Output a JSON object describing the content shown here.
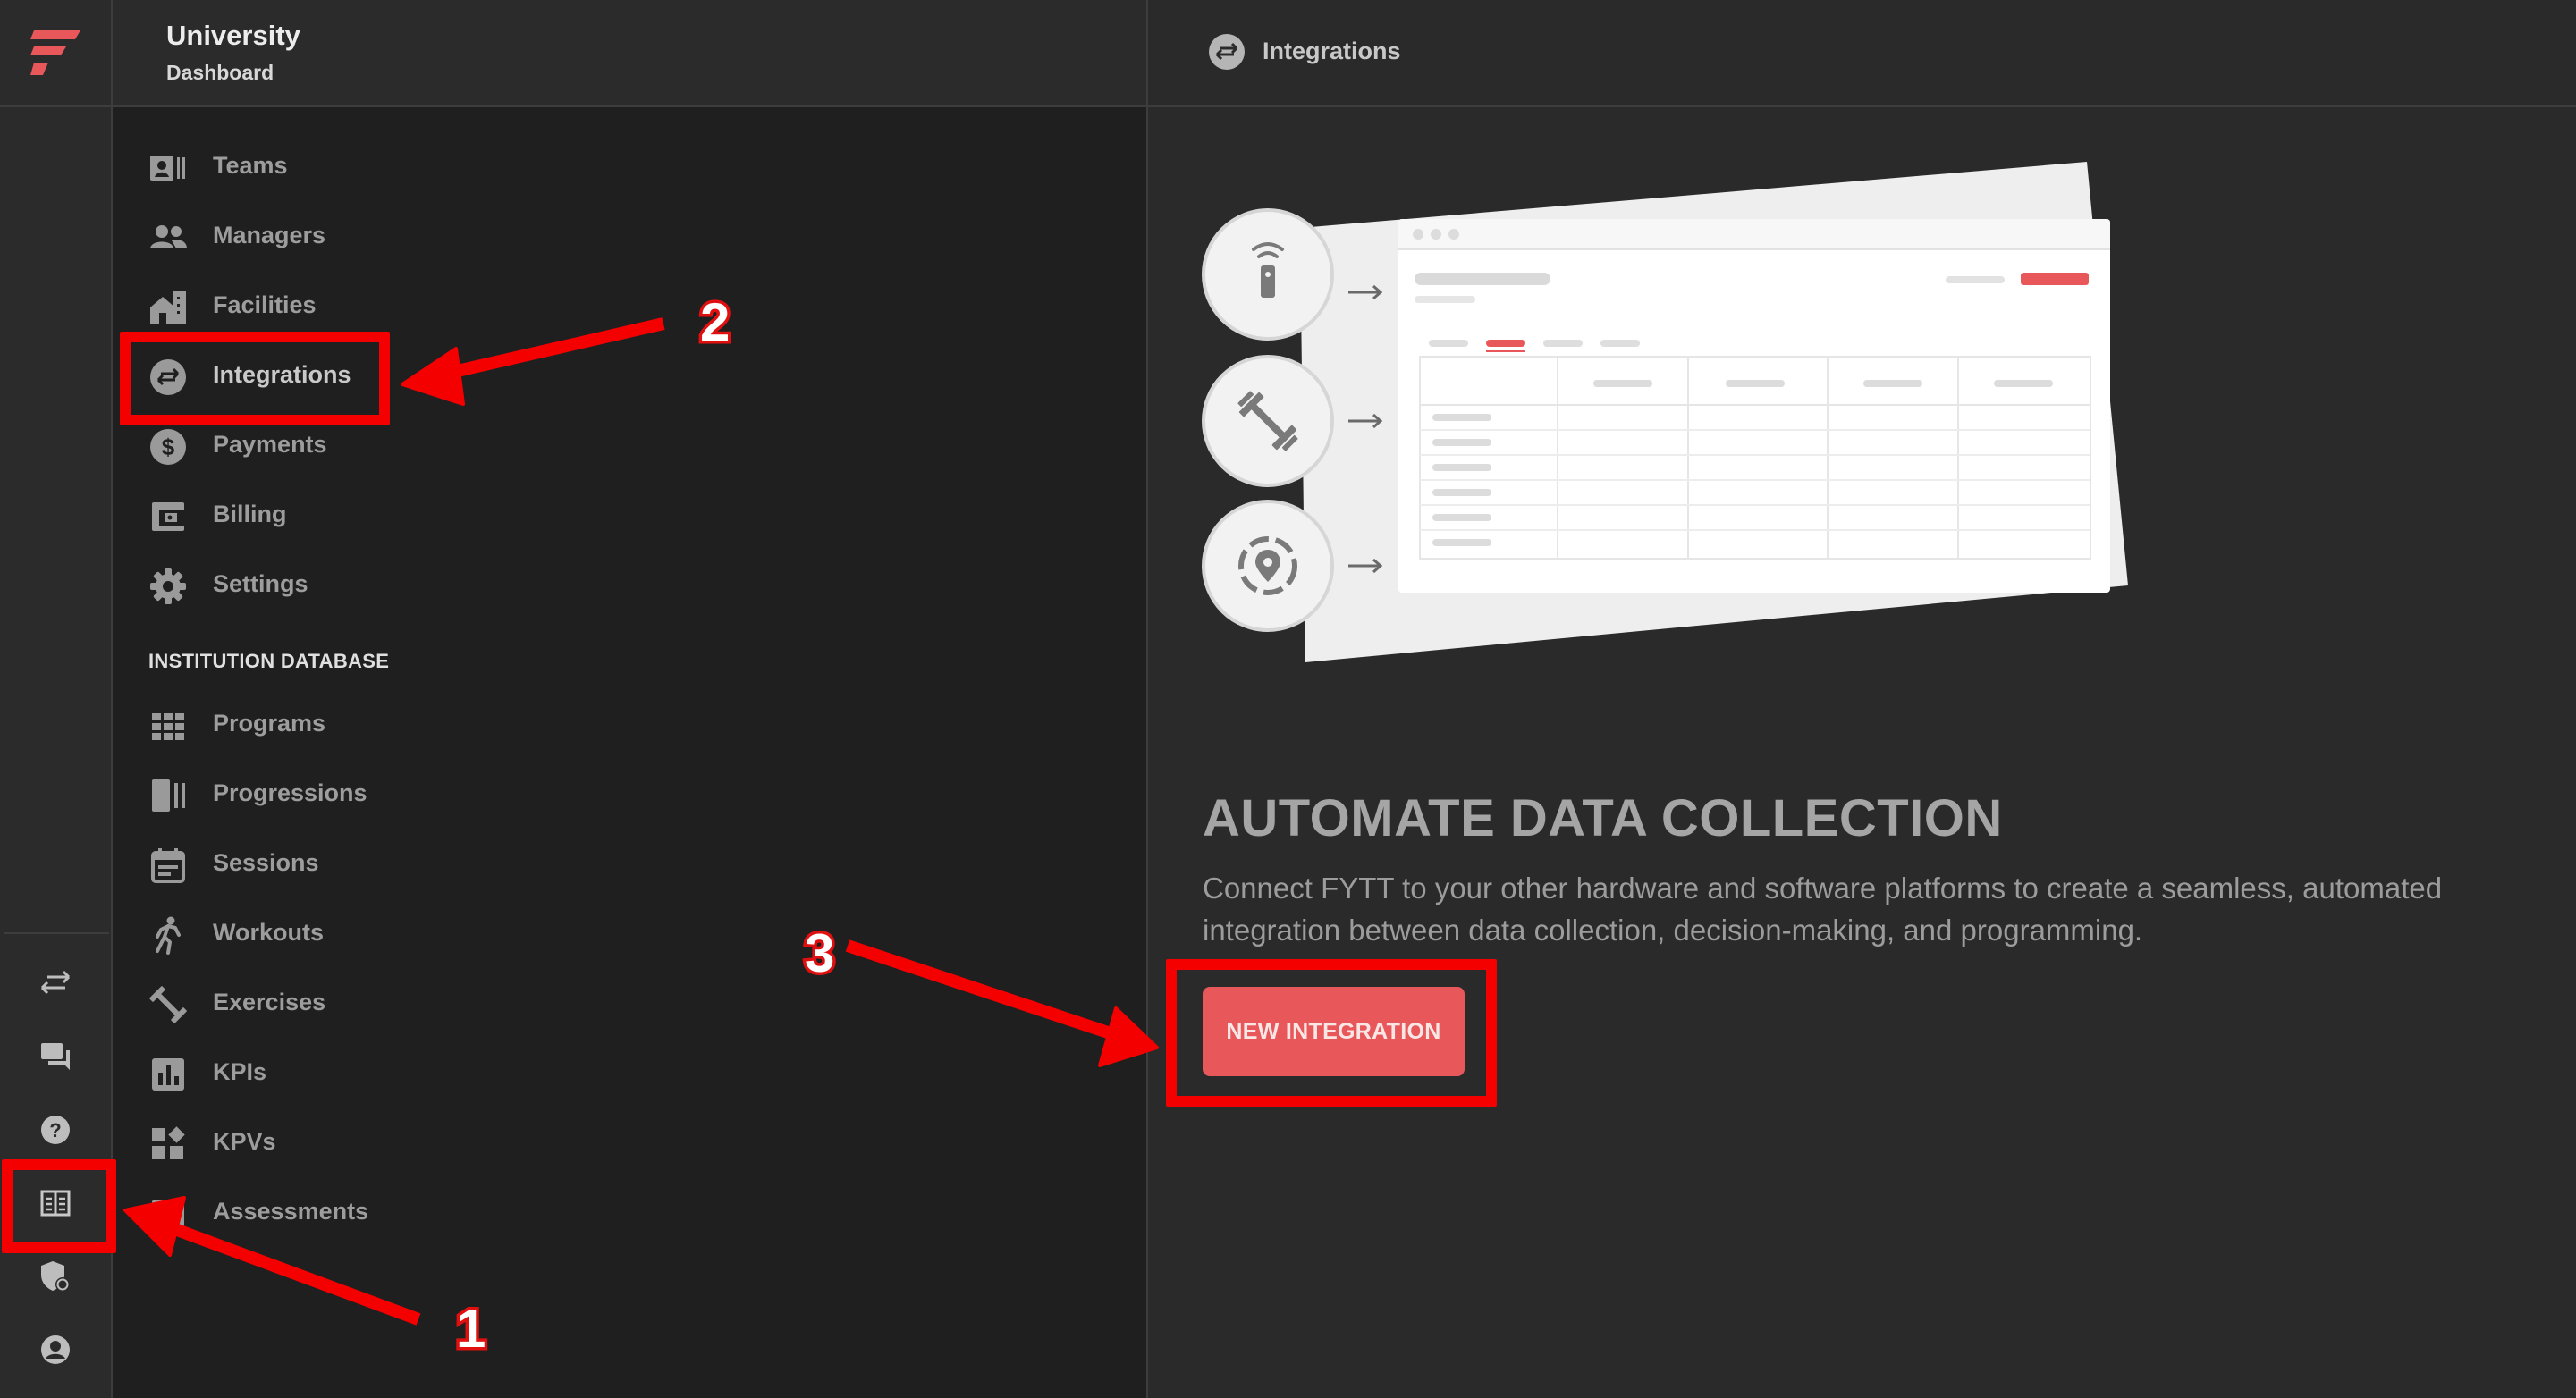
{
  "app": {
    "org_name": "University",
    "org_subtitle": "Dashboard",
    "brand_color": "#e8585a"
  },
  "rail": {
    "icons": [
      "integrations-icon",
      "chat-icon",
      "help-icon",
      "dashboard-icon",
      "security-icon",
      "account-icon"
    ]
  },
  "sidebar": {
    "items": [
      {
        "label": "Teams",
        "icon": "teams-icon"
      },
      {
        "label": "Managers",
        "icon": "managers-icon"
      },
      {
        "label": "Facilities",
        "icon": "facilities-icon"
      },
      {
        "label": "Integrations",
        "icon": "integrations-icon"
      },
      {
        "label": "Payments",
        "icon": "payments-icon"
      },
      {
        "label": "Billing",
        "icon": "billing-icon"
      },
      {
        "label": "Settings",
        "icon": "settings-icon"
      }
    ],
    "section_title": "INSTITUTION DATABASE",
    "db_items": [
      {
        "label": "Programs",
        "icon": "programs-icon"
      },
      {
        "label": "Progressions",
        "icon": "progressions-icon"
      },
      {
        "label": "Sessions",
        "icon": "sessions-icon"
      },
      {
        "label": "Workouts",
        "icon": "workouts-icon"
      },
      {
        "label": "Exercises",
        "icon": "exercises-icon"
      },
      {
        "label": "KPIs",
        "icon": "kpis-icon"
      },
      {
        "label": "KPVs",
        "icon": "kpvs-icon"
      },
      {
        "label": "Assessments",
        "icon": "assessments-icon"
      }
    ]
  },
  "main": {
    "page_title": "Integrations",
    "headline": "AUTOMATE DATA COLLECTION",
    "description": "Connect FYTT to your other hardware and software platforms to create a seamless, automated integration between data collection, decision-making, and programming.",
    "cta_label": "NEW INTEGRATION"
  },
  "annotations": {
    "step1": "1",
    "step2": "2",
    "step3": "3",
    "color": "#f40000"
  }
}
